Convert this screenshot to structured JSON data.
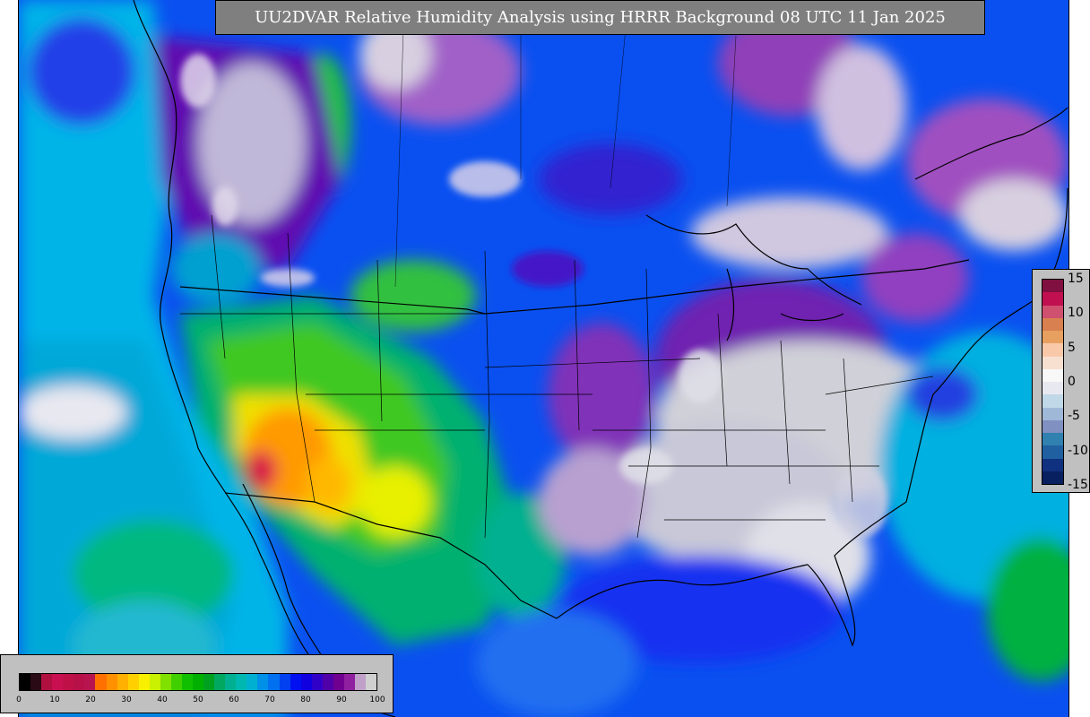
{
  "title": "UU2DVAR Relative Humidity Analysis using HRRR Background 08 UTC 11 Jan 2025",
  "colorbar": {
    "ticks": [
      "0",
      "10",
      "20",
      "30",
      "40",
      "50",
      "60",
      "70",
      "80",
      "90",
      "100"
    ],
    "colors": [
      "#000000",
      "#2a0a14",
      "#b01040",
      "#c81050",
      "#c01048",
      "#b81048",
      "#b81450",
      "#ff7000",
      "#ff9000",
      "#ffb000",
      "#ffd000",
      "#f8f000",
      "#c8f000",
      "#80e000",
      "#40d000",
      "#10c000",
      "#00b000",
      "#00a020",
      "#00a860",
      "#00b090",
      "#00b8b0",
      "#00b0d0",
      "#0090e8",
      "#0070f0",
      "#0040f0",
      "#0010f0",
      "#1000e0",
      "#3000c8",
      "#5000a8",
      "#700090",
      "#9020a0",
      "#c0a0c8",
      "#d0d0d0"
    ]
  },
  "legend": {
    "ticks": [
      "15",
      "10",
      "5",
      "0",
      "-5",
      "-10",
      "-15"
    ],
    "colors": [
      "#801040",
      "#c01050",
      "#d05070",
      "#d88050",
      "#e8a060",
      "#f8c8a8",
      "#f8e0d0",
      "#f8f8f8",
      "#e8e8f0",
      "#c0d8e8",
      "#a0b8d8",
      "#8090c0",
      "#3080b0",
      "#2060a0",
      "#103080",
      "#082060"
    ]
  }
}
